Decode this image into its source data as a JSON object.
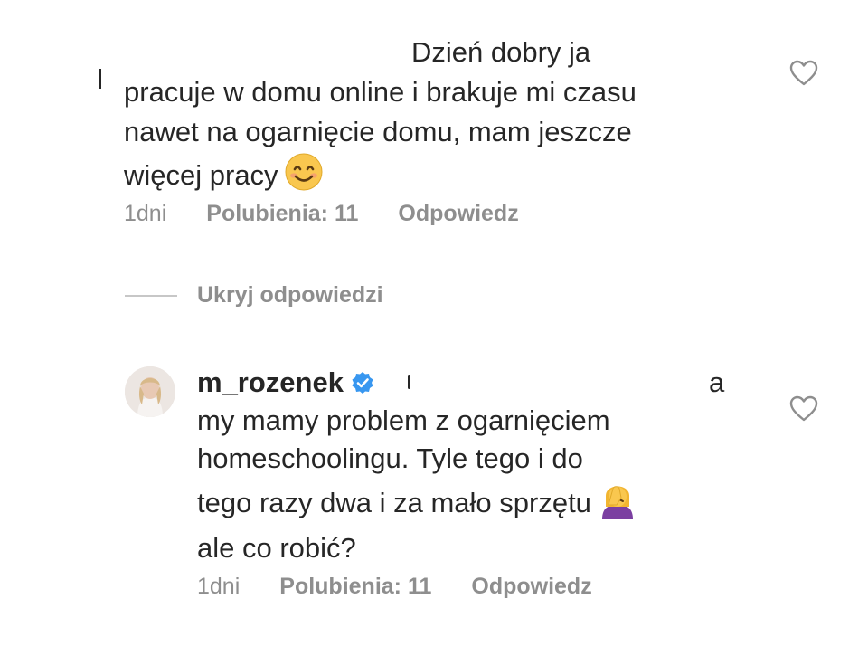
{
  "comment1": {
    "line1": "Dzień dobry ja",
    "line2": "pracuje w domu online i brakuje mi czasu",
    "line3": "nawet na ogarnięcie domu, mam jeszcze",
    "line4": "więcej pracy",
    "emoji": "smiling-face-emoji",
    "time": "1dni",
    "likes": "Polubienia: 11",
    "reply": "Odpowiedz"
  },
  "hide_replies": "Ukryj odpowiedzi",
  "comment2": {
    "username": "m_rozenek",
    "verified_icon": "verified-badge-icon",
    "line1_tail": "a",
    "line2": "my mamy problem z ogarnięciem",
    "line3": "homeschoolingu. Tyle tego i do",
    "line4": "tego razy dwa i za mało sprzętu",
    "line5": "ale co robić?",
    "emoji": "facepalm-emoji",
    "time": "1dni",
    "likes": "Polubienia: 11",
    "reply": "Odpowiedz"
  },
  "colors": {
    "text": "#262626",
    "muted": "#8e8e8e",
    "verified": "#3897f0",
    "rule": "#c7c7c7"
  }
}
